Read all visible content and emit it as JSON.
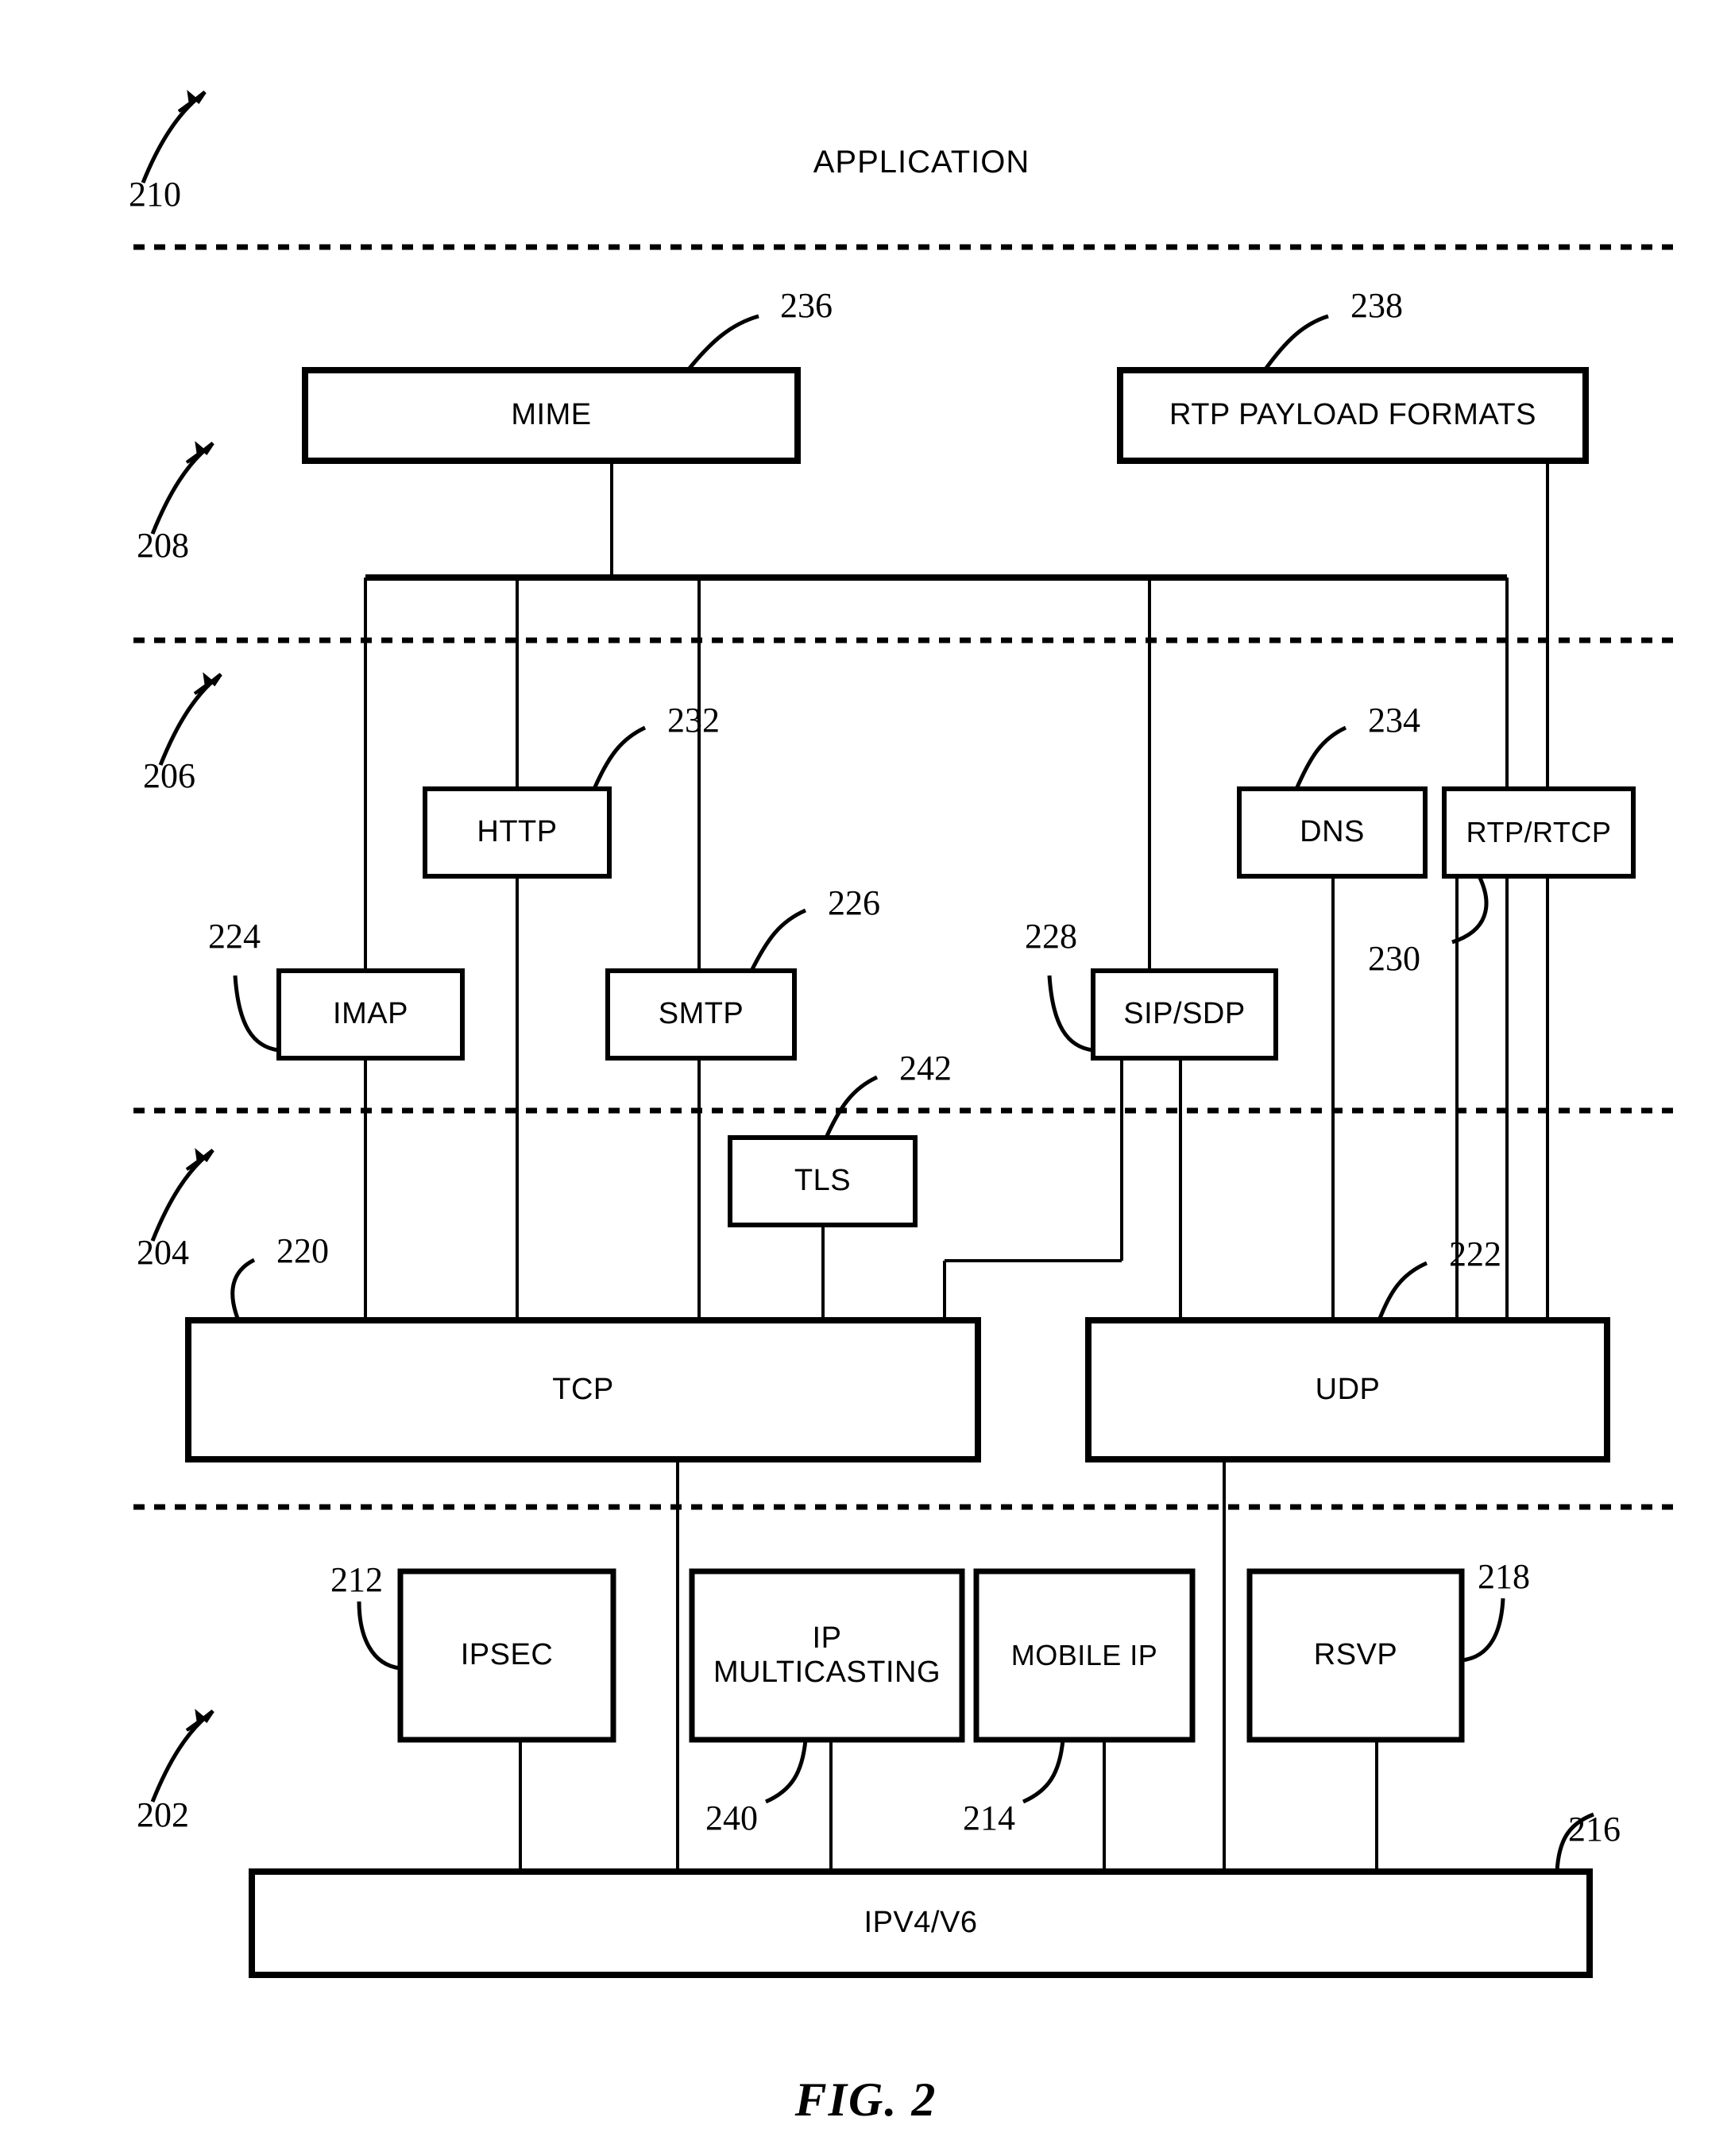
{
  "figure": {
    "caption": "FIG. 2",
    "application_layer_label": "APPLICATION"
  },
  "layer_refs": [
    {
      "id": "210",
      "label": "210"
    },
    {
      "id": "208",
      "label": "208"
    },
    {
      "id": "206",
      "label": "206"
    },
    {
      "id": "204",
      "label": "204"
    },
    {
      "id": "202",
      "label": "202"
    }
  ],
  "boxes": [
    {
      "key": "mime",
      "label": "MIME",
      "ref": "236"
    },
    {
      "key": "rtp_pf",
      "label": "RTP PAYLOAD FORMATS",
      "ref": "238"
    },
    {
      "key": "http",
      "label": "HTTP",
      "ref": "232"
    },
    {
      "key": "dns",
      "label": "DNS",
      "ref": "234"
    },
    {
      "key": "rtprtcp",
      "label": "RTP/RTCP",
      "ref": "230"
    },
    {
      "key": "imap",
      "label": "IMAP",
      "ref": "224"
    },
    {
      "key": "smtp",
      "label": "SMTP",
      "ref": "226"
    },
    {
      "key": "sipsdp",
      "label": "SIP/SDP",
      "ref": "228"
    },
    {
      "key": "tls",
      "label": "TLS",
      "ref": "242"
    },
    {
      "key": "tcp",
      "label": "TCP",
      "ref": "220"
    },
    {
      "key": "udp",
      "label": "UDP",
      "ref": "222"
    },
    {
      "key": "ipsec",
      "label": "IPSEC",
      "ref": "212"
    },
    {
      "key": "ipmcast",
      "label": "IP MULTICASTING",
      "ref": "240"
    },
    {
      "key": "mobileip",
      "label": "MOBILE IP",
      "ref": "214"
    },
    {
      "key": "rsvp",
      "label": "RSVP",
      "ref": "218"
    },
    {
      "key": "ipv4v6",
      "label": "IPV4/V6",
      "ref": "216"
    }
  ],
  "box_labels": {
    "mime": "MIME",
    "rtp_pf": "RTP PAYLOAD FORMATS",
    "http": "HTTP",
    "dns": "DNS",
    "rtprtcp": "RTP/RTCP",
    "imap": "IMAP",
    "smtp": "SMTP",
    "sipsdp": "SIP/SDP",
    "tls": "TLS",
    "tcp": "TCP",
    "udp": "UDP",
    "ipsec": "IPSEC",
    "ipmcast_line1": "IP",
    "ipmcast_line2": "MULTICASTING",
    "mobileip": "MOBILE IP",
    "rsvp": "RSVP",
    "ipv4v6": "IPV4/V6"
  },
  "ref_numbers": {
    "n202": "202",
    "n204": "204",
    "n206": "206",
    "n208": "208",
    "n210": "210",
    "n212": "212",
    "n214": "214",
    "n216": "216",
    "n218": "218",
    "n220": "220",
    "n222": "222",
    "n224": "224",
    "n226": "226",
    "n228": "228",
    "n230": "230",
    "n232": "232",
    "n234": "234",
    "n236": "236",
    "n238": "238",
    "n240": "240",
    "n242": "242"
  },
  "colors": {
    "ink": "#000000",
    "paper": "#ffffff"
  }
}
